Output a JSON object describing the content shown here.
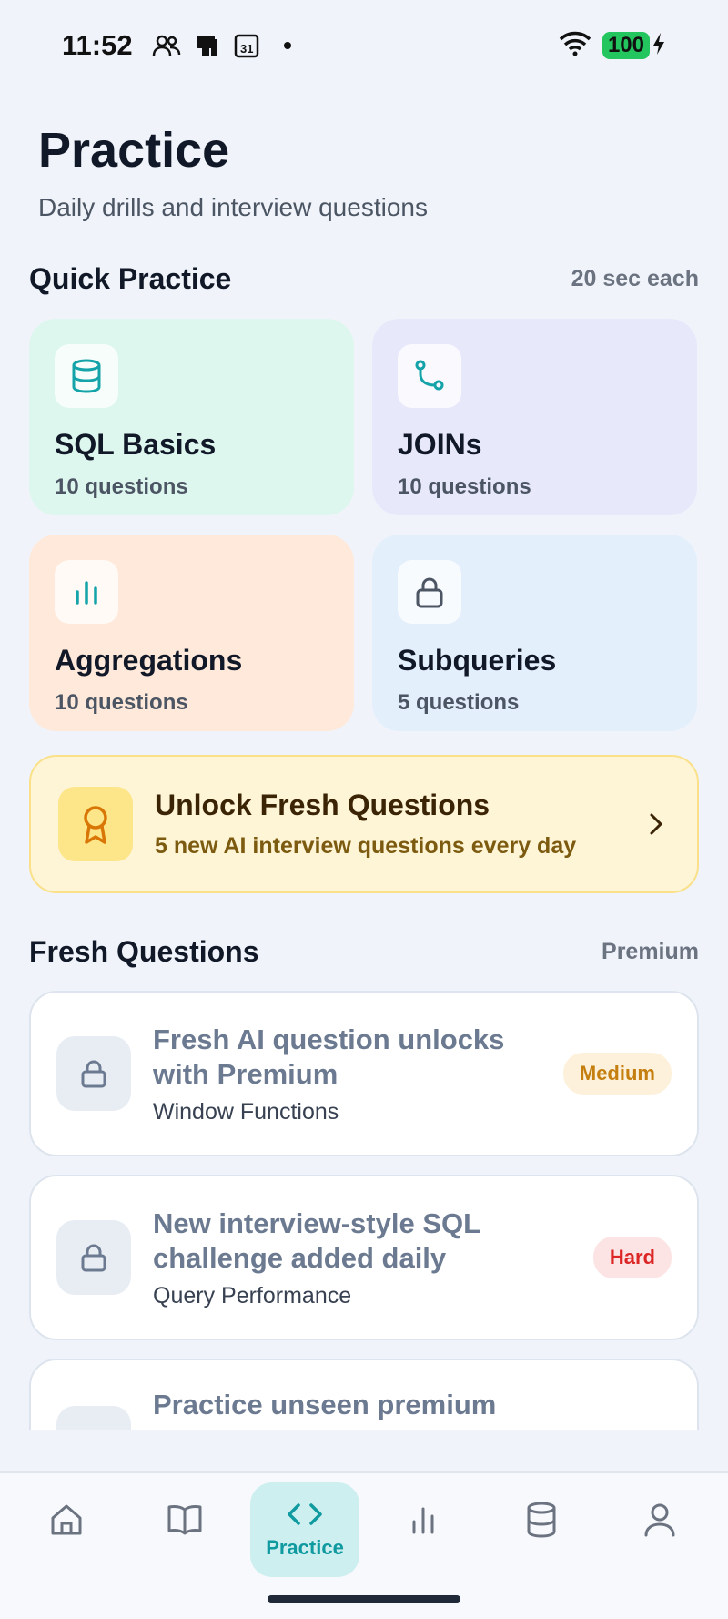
{
  "status": {
    "time": "11:52",
    "battery": "100"
  },
  "header": {
    "title": "Practice",
    "subtitle": "Daily drills and interview questions"
  },
  "quick_practice": {
    "title": "Quick Practice",
    "meta": "20 sec each",
    "cards": [
      {
        "title": "SQL Basics",
        "count": "10 questions",
        "icon": "database-icon",
        "bg": "#def7ee",
        "accent": "#14a3a8"
      },
      {
        "title": "JOINs",
        "count": "10 questions",
        "icon": "branch-icon",
        "bg": "#e8e8fb",
        "accent": "#14a3a8"
      },
      {
        "title": "Aggregations",
        "count": "10 questions",
        "icon": "bar-chart-icon",
        "bg": "#fee9da",
        "accent": "#14a3a8"
      },
      {
        "title": "Subqueries",
        "count": "5 questions",
        "icon": "lock-icon",
        "bg": "#e4effc",
        "accent": "#4b5563"
      }
    ]
  },
  "unlock": {
    "title": "Unlock Fresh Questions",
    "subtitle": "5 new AI interview questions every day"
  },
  "fresh": {
    "title": "Fresh Questions",
    "meta": "Premium",
    "items": [
      {
        "title_line1": "Fresh AI question unlocks",
        "title_line2": "with Premium",
        "topic": "Window Functions",
        "difficulty": "Medium"
      },
      {
        "title_line1": "New interview-style SQL",
        "title_line2": "challenge added daily",
        "topic": "Query Performance",
        "difficulty": "Hard"
      },
      {
        "title_line1": "Practice unseen premium",
        "title_line2": "",
        "topic": "",
        "difficulty": ""
      }
    ]
  },
  "nav": {
    "active_label": "Practice"
  },
  "colors": {
    "accent": "#0f9aa0",
    "background": "#f0f4fa"
  }
}
